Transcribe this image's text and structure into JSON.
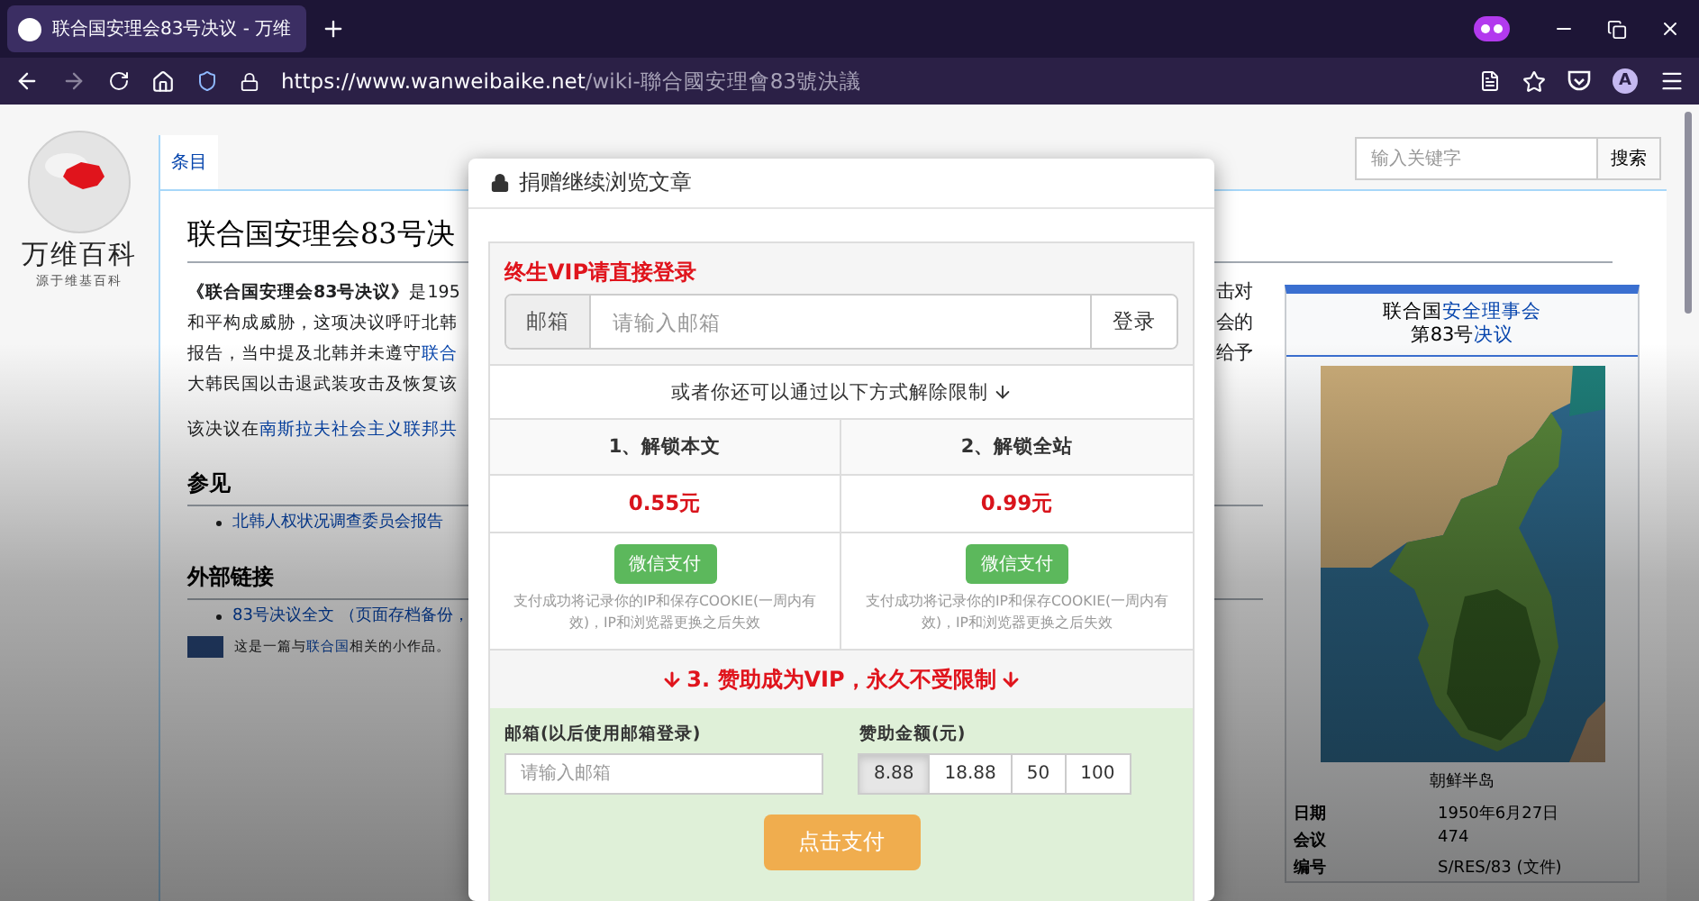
{
  "browser": {
    "tab_title": "联合国安理会83号决议 - 万维",
    "url_host": "https://www.wanweibaike.net",
    "url_path": "/wiki-聯合國安理會83號決議",
    "account_initial": "A"
  },
  "site": {
    "logo_name": "万维百科",
    "logo_tagline": "源于维基百科",
    "tabs": [
      {
        "label": "条目",
        "selected": true
      }
    ],
    "search": {
      "placeholder": "输入关键字",
      "button": "搜索"
    }
  },
  "article": {
    "title": "联合国安理会83号决",
    "lead": [
      {
        "left": [
          {
            "text": "《联合国安理会83号决议》",
            "link": false,
            "bold": true
          },
          {
            "text": "是195",
            "link": false
          }
        ],
        "right": "击对"
      },
      {
        "left": [
          {
            "text": "和平构成威胁，这项决议呼吁北韩",
            "link": false
          }
        ],
        "right": "会的"
      },
      {
        "left": [
          {
            "text": "报告，当中提及北韩并未遵守",
            "link": false
          },
          {
            "text": "联合",
            "link": true
          }
        ],
        "right": "给予"
      },
      {
        "left": [
          {
            "text": "大韩民国以击退武装攻击及恢复该",
            "link": false
          }
        ]
      }
    ],
    "para2": [
      {
        "text": "该决议在",
        "link": false
      },
      {
        "text": "南斯拉夫社会主义联邦共",
        "link": true
      }
    ],
    "sections": [
      {
        "heading": "参见",
        "items": [
          "北韩人权状况调查委员会报告"
        ]
      },
      {
        "heading": "外部链接",
        "items": [
          "83号决议全文 （页面存档备份，"
        ]
      }
    ],
    "stub": [
      {
        "text": "这是一篇与",
        "link": false
      },
      {
        "text": "联合国",
        "link": true
      },
      {
        "text": "相关的小作品。",
        "link": false
      }
    ]
  },
  "infobox": {
    "title_lines": [
      [
        {
          "text": "联合国",
          "link": false
        },
        {
          "text": "安全理事会",
          "link": true
        }
      ],
      [
        {
          "text": "第83号",
          "link": false
        },
        {
          "text": "决议",
          "link": true
        }
      ]
    ],
    "caption": "朝鲜半岛",
    "rows": [
      {
        "label": "日期",
        "value": "1950年6月27日"
      },
      {
        "label": "会议",
        "value": "474"
      },
      {
        "label": "编号",
        "value": "S/RES/83 (文件)"
      }
    ]
  },
  "modal": {
    "title": "捐赠继续浏览文章",
    "vip_title": "终生VIP请直接登录",
    "email_addon": "邮箱",
    "email_placeholder": "请输入邮箱",
    "login_button": "登录",
    "alt_text": "或者你还可以通过以下方式解除限制",
    "options": [
      {
        "heading": "1、解锁本文",
        "price": "0.55元",
        "pay_button": "微信支付",
        "note": "支付成功将记录你的IP和保存COOKIE(一周内有效)，IP和浏览器更换之后失效"
      },
      {
        "heading": "2、解锁全站",
        "price": "0.99元",
        "pay_button": "微信支付",
        "note": "支付成功将记录你的IP和保存COOKIE(一周内有效)，IP和浏览器更换之后失效"
      }
    ],
    "vip_band": "3. 赞助成为VIP，永久不受限制",
    "vip_email_label": "邮箱(以后使用邮箱登录)",
    "vip_email_placeholder": "请输入邮箱",
    "amount_label": "赞助金额(元)",
    "amounts": [
      {
        "label": "8.88",
        "selected": true
      },
      {
        "label": "18.88",
        "selected": false
      },
      {
        "label": "50",
        "selected": false
      },
      {
        "label": "100",
        "selected": false
      }
    ],
    "submit_button": "点击支付"
  }
}
